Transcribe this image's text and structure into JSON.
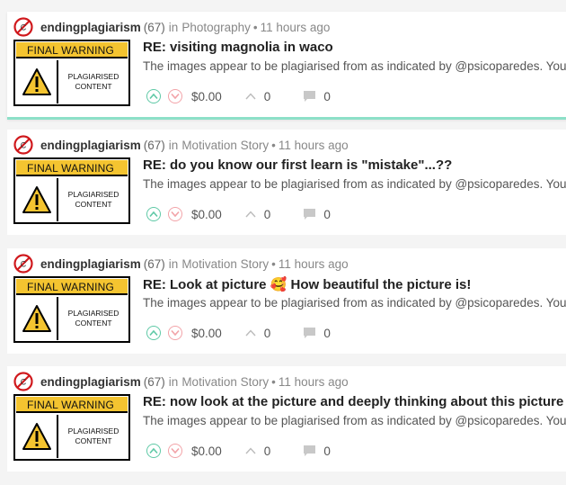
{
  "posts": [
    {
      "author": "endingplagiarism",
      "reputation": "(67)",
      "in_word": "in",
      "category": "Photography",
      "dot": "•",
      "time": "11 hours ago",
      "thumb": {
        "banner": "FINAL WARNING",
        "line1": "PLAGIARISED",
        "line2": "CONTENT"
      },
      "title": "RE: visiting magnolia in waco",
      "excerpt": "The images appear to be plagiarised from as indicated by @psicoparedes. You h",
      "payout": "$0.00",
      "votes": "0",
      "comments": "0",
      "active": true
    },
    {
      "author": "endingplagiarism",
      "reputation": "(67)",
      "in_word": "in",
      "category": "Motivation Story",
      "dot": "•",
      "time": "11 hours ago",
      "thumb": {
        "banner": "FINAL WARNING",
        "line1": "PLAGIARISED",
        "line2": "CONTENT"
      },
      "title": "RE: do you know our first learn is \"mistake\"...??",
      "excerpt": "The images appear to be plagiarised from as indicated by @psicoparedes. You h",
      "payout": "$0.00",
      "votes": "0",
      "comments": "0",
      "active": false
    },
    {
      "author": "endingplagiarism",
      "reputation": "(67)",
      "in_word": "in",
      "category": "Motivation Story",
      "dot": "•",
      "time": "11 hours ago",
      "thumb": {
        "banner": "FINAL WARNING",
        "line1": "PLAGIARISED",
        "line2": "CONTENT"
      },
      "title": "RE: Look at picture 🥰 How beautiful the picture is!",
      "excerpt": "The images appear to be plagiarised from as indicated by @psicoparedes. You h",
      "payout": "$0.00",
      "votes": "0",
      "comments": "0",
      "active": false
    },
    {
      "author": "endingplagiarism",
      "reputation": "(67)",
      "in_word": "in",
      "category": "Motivation Story",
      "dot": "•",
      "time": "11 hours ago",
      "thumb": {
        "banner": "FINAL WARNING",
        "line1": "PLAGIARISED",
        "line2": "CONTENT"
      },
      "title": "RE: now look at the picture and deeply thinking about this picture",
      "excerpt": "The images appear to be plagiarised from as indicated by @psicoparedes. You h",
      "payout": "$0.00",
      "votes": "0",
      "comments": "0",
      "active": false
    }
  ],
  "colors": {
    "accent": "#8de0c8",
    "warning_yellow": "#f4c430",
    "upvote": "#5fc9a6",
    "downvote": "#f2a3a8"
  }
}
